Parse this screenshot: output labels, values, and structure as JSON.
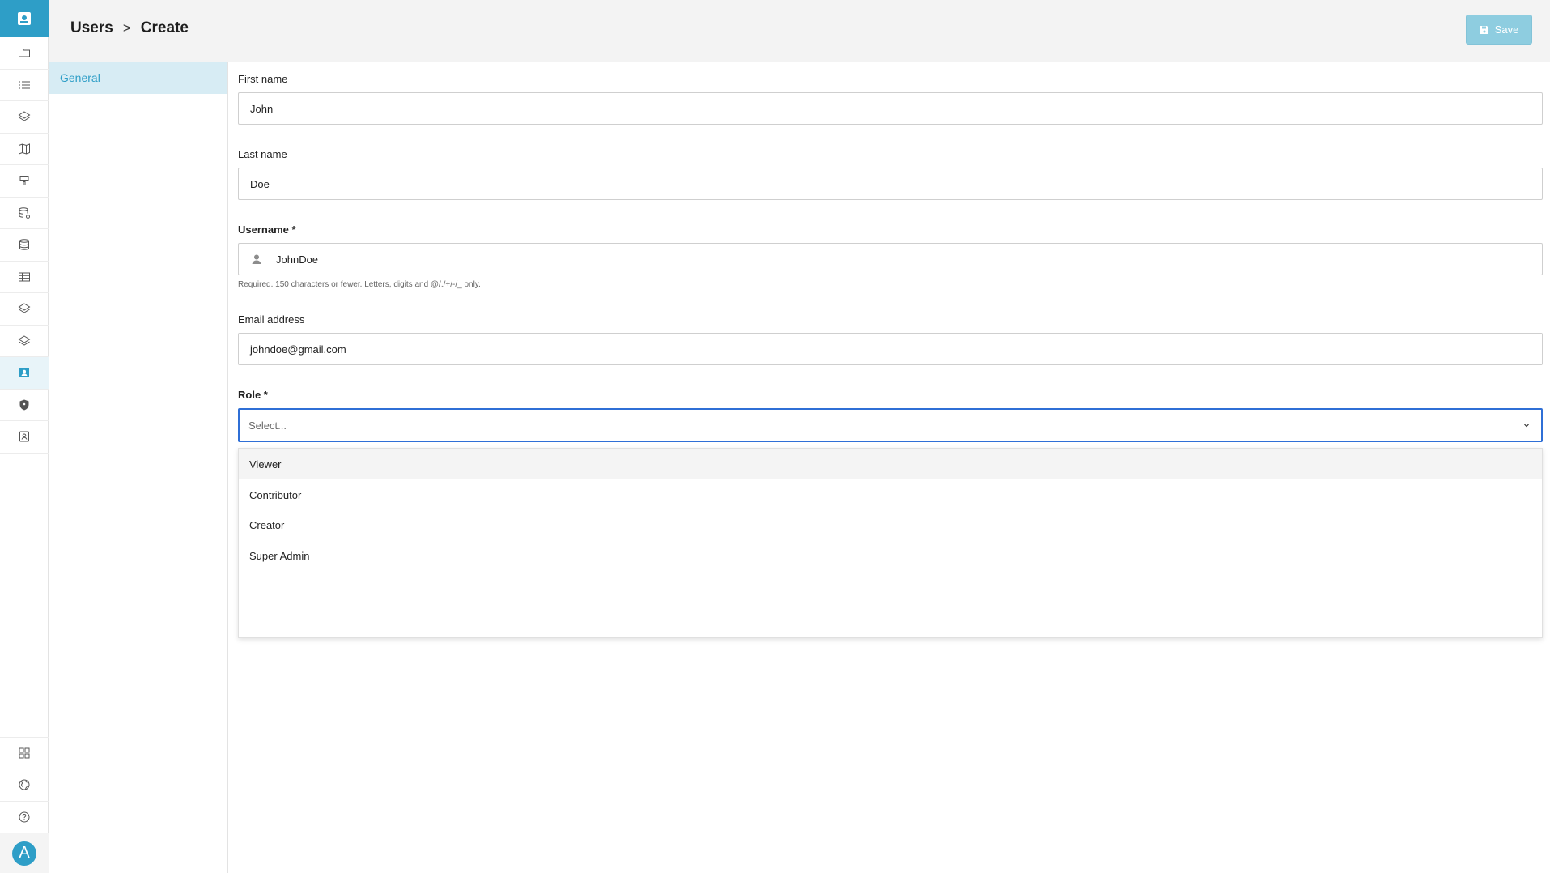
{
  "header": {
    "breadcrumb": [
      "Users",
      "Create"
    ],
    "separator": ">",
    "save_label": "Save"
  },
  "sidebar": {
    "avatar_letter": "A",
    "items": [
      {
        "icon": "folder-icon"
      },
      {
        "icon": "list-icon"
      },
      {
        "icon": "layers-icon"
      },
      {
        "icon": "map-icon"
      },
      {
        "icon": "paint-icon"
      },
      {
        "icon": "database-settings-icon"
      },
      {
        "icon": "database-icon"
      },
      {
        "icon": "table-icon"
      },
      {
        "icon": "layers-icon"
      },
      {
        "icon": "layers-icon"
      },
      {
        "icon": "user-card-icon",
        "active": true
      },
      {
        "icon": "shield-icon"
      },
      {
        "icon": "contact-icon"
      }
    ],
    "bottom_items": [
      {
        "icon": "apps-icon"
      },
      {
        "icon": "globe-icon"
      },
      {
        "icon": "help-icon"
      }
    ]
  },
  "sections": [
    {
      "label": "General",
      "active": true
    }
  ],
  "form": {
    "first_name": {
      "label": "First name",
      "value": "John"
    },
    "last_name": {
      "label": "Last name",
      "value": "Doe"
    },
    "username": {
      "label": "Username *",
      "value": "JohnDoe",
      "help": "Required. 150 characters or fewer. Letters, digits and @/./+/-/_ only."
    },
    "email": {
      "label": "Email address",
      "value": "johndoe@gmail.com"
    },
    "role": {
      "label": "Role *",
      "placeholder": "Select...",
      "options": [
        "Viewer",
        "Contributor",
        "Creator",
        "Super Admin"
      ],
      "hovered_option": "Viewer"
    }
  },
  "colors": {
    "brand": "#2e9ec7",
    "focus": "#2f6fd6",
    "save_button": "#8ecde0"
  }
}
